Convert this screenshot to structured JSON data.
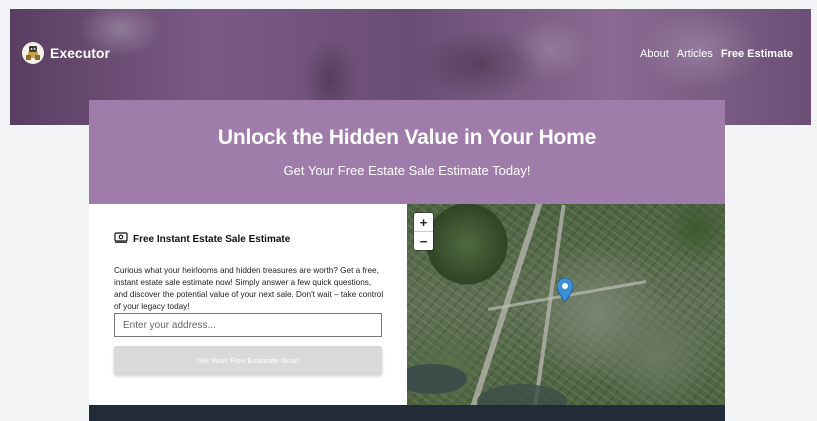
{
  "header": {
    "brand": "Executor",
    "nav": [
      {
        "label": "About"
      },
      {
        "label": "Articles"
      },
      {
        "label": "Free Estimate",
        "active": true
      }
    ]
  },
  "banner": {
    "title": "Unlock the Hidden Value in Your Home",
    "subtitle": "Get Your Free Estate Sale Estimate Today!",
    "background_color": "#a07cab"
  },
  "form": {
    "title": "Free Instant Estate Sale Estimate",
    "icon": "money-icon",
    "description": "Curious what your heirlooms and hidden treasures are worth? Get a free, instant estate sale estimate now! Simply answer a few quick questions, and discover the potential value of your next sale. Don't wait – take control of your legacy today!",
    "address_placeholder": "Enter your address...",
    "address_value": "",
    "submit_label": "Get Your Free Estimate Now!"
  },
  "map": {
    "zoom_in": "+",
    "zoom_out": "−",
    "marker_color": "#3a8fd6"
  },
  "colors": {
    "footer": "#222b38",
    "page_bg": "#f3f4f6"
  }
}
